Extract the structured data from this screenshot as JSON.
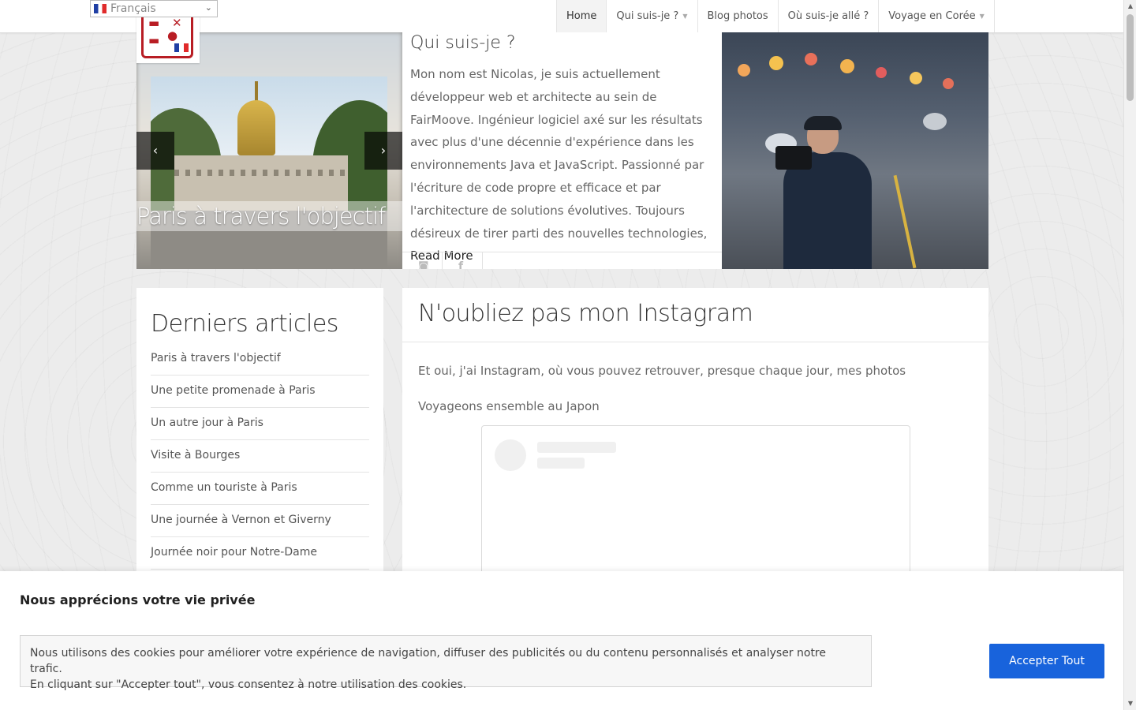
{
  "language_selector": {
    "value": "Français"
  },
  "nav": {
    "items": [
      {
        "label": "Home",
        "has_dropdown": false
      },
      {
        "label": "Qui suis-je ?",
        "has_dropdown": true
      },
      {
        "label": "Blog photos",
        "has_dropdown": false
      },
      {
        "label": "Où suis-je allé ?",
        "has_dropdown": false
      },
      {
        "label": "Voyage en Corée",
        "has_dropdown": true
      }
    ],
    "active": "Home"
  },
  "slider": {
    "caption": "Paris à travers l'objectif",
    "prev_icon": "chevron-left-icon",
    "next_icon": "chevron-right-icon"
  },
  "about": {
    "title": "Qui suis-je ?",
    "text": "Mon nom est Nicolas, je suis actuellement développeur web et architecte au sein de FairMoove. Ingénieur logiciel axé sur les résultats avec plus d'une décennie d'expérience dans les environnements Java et JavaScript. Passionné par l'écriture de code propre et efficace et par l'architecture de solutions évolutives. Toujours désireux de tirer parti des nouvelles technologies,",
    "read_more": "Read More",
    "social_icons": [
      "instagram-icon",
      "facebook-icon"
    ]
  },
  "sidebar": {
    "title": "Derniers articles",
    "articles": [
      "Paris à travers l'objectif",
      "Une petite promenade à Paris",
      "Un autre jour à Paris",
      "Visite à Bourges",
      "Comme un touriste à Paris",
      "Une journée à Vernon et Giverny",
      "Journée noir pour Notre-Dame"
    ]
  },
  "main": {
    "title": "N'oubliez pas mon Instagram",
    "paragraph1": "Et oui, j'ai Instagram, où vous pouvez retrouver, presque chaque jour, mes photos",
    "paragraph2": "Voyageons ensemble au Japon"
  },
  "cookie": {
    "title": "Nous apprécions votre vie privée",
    "text_line1": "Nous utilisons des cookies pour améliorer votre expérience de navigation, diffuser des publicités ou du contenu personnalisés et analyser notre trafic.",
    "text_line2": "En cliquant sur \"Accepter tout\", vous consentez à notre utilisation des cookies.",
    "accept_label": "Accepter Tout",
    "accent_color": "#1863dc"
  }
}
